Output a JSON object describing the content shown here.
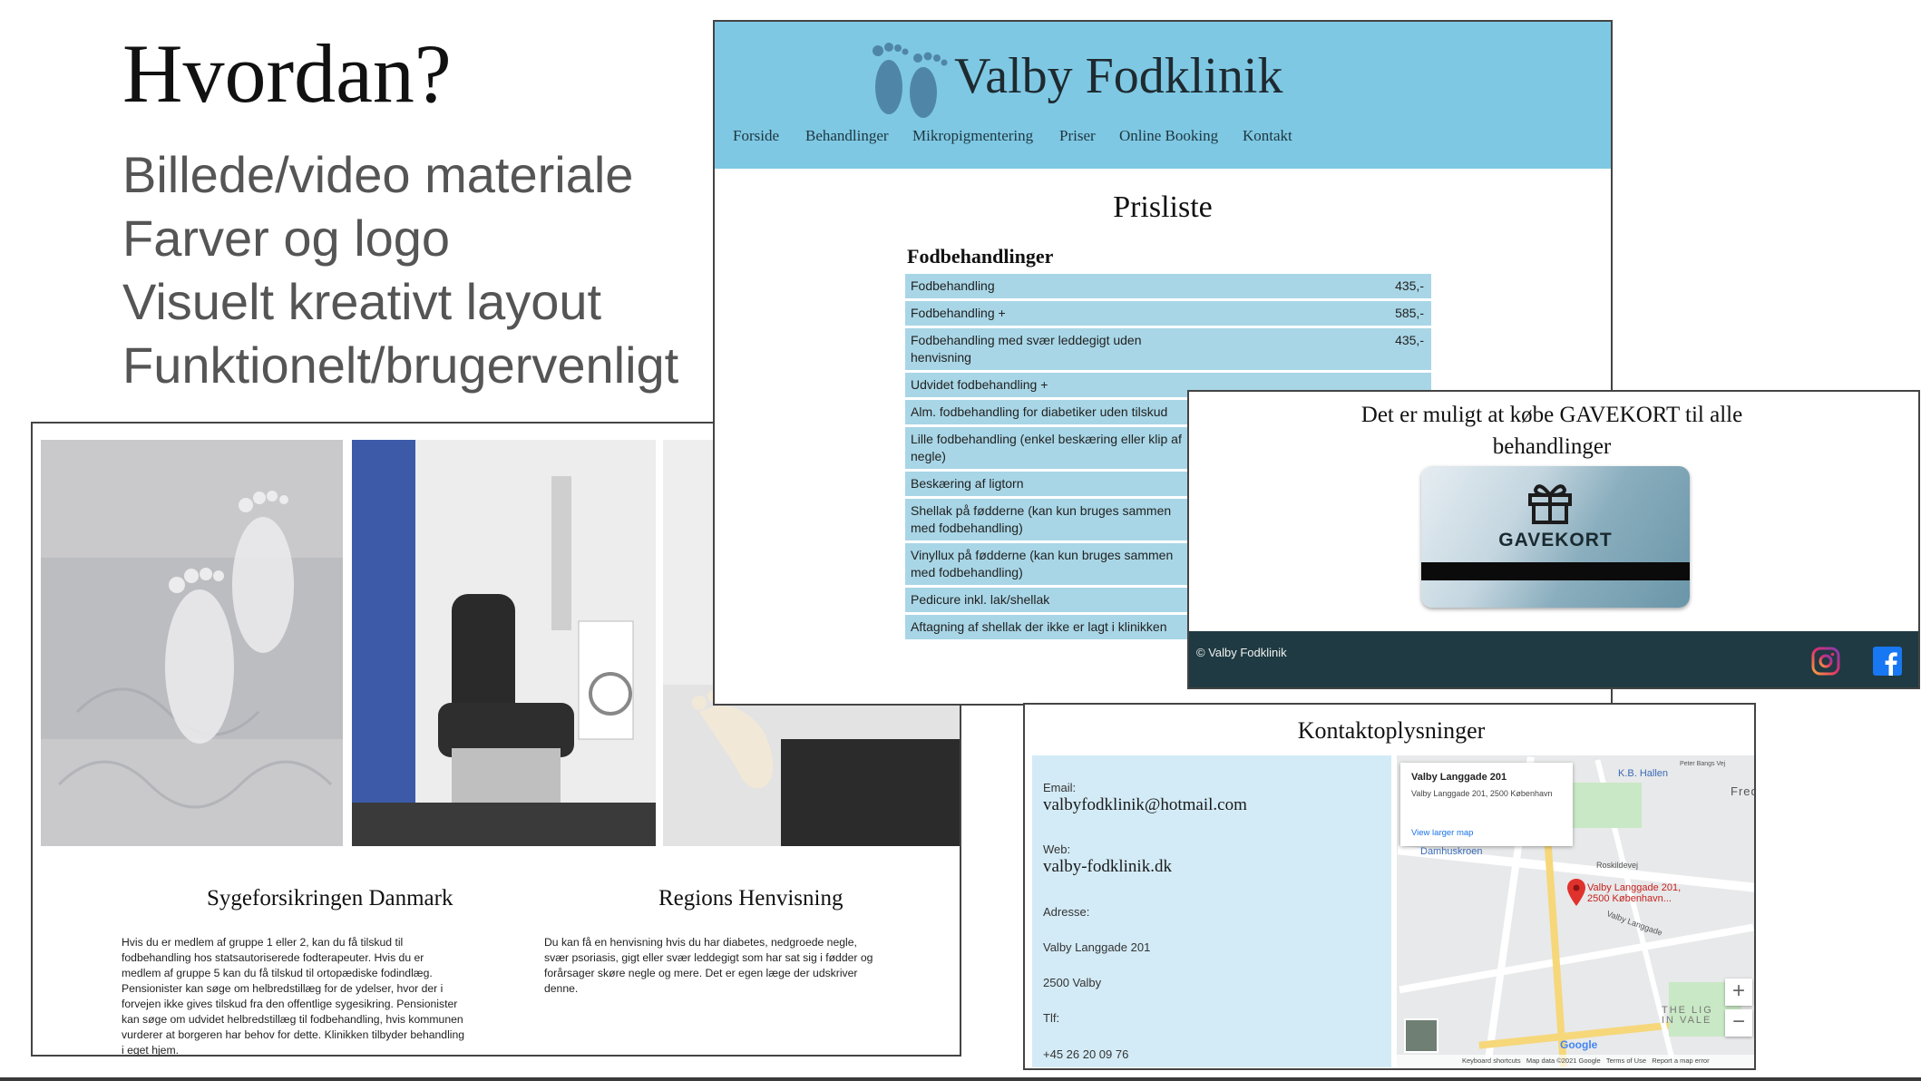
{
  "slide": {
    "title": "Hvordan?",
    "bullets": [
      "Billede/video materiale",
      "Farver og logo",
      "Visuelt kreativt layout",
      "Funktionelt/brugervenligt"
    ]
  },
  "site": {
    "brand": "Valby Fodklinik",
    "nav": [
      "Forside",
      "Behandlinger",
      "Mikropigmentering",
      "Priser",
      "Online Booking",
      "Kontakt"
    ],
    "price_title": "Prisliste",
    "price_section": "Fodbehandlinger",
    "prices": [
      {
        "name": "Fodbehandling",
        "value": "435,-"
      },
      {
        "name": "Fodbehandling +",
        "value": "585,-"
      },
      {
        "name": "Fodbehandling med svær leddegigt uden henvisning",
        "value": "435,-"
      },
      {
        "name": "Udvidet fodbehandling +",
        "value": ""
      },
      {
        "name": "Alm. fodbehandling for diabetiker uden tilskud",
        "value": ""
      },
      {
        "name": "Lille fodbehandling (enkel beskæring eller klip af negle)",
        "value": ""
      },
      {
        "name": "Beskæring af ligtorn",
        "value": ""
      },
      {
        "name": "Shellak på fødderne (kan kun bruges sammen med fodbehandling)",
        "value": ""
      },
      {
        "name": "Vinyllux på fødderne (kan kun bruges sammen med fodbehandling)",
        "value": ""
      },
      {
        "name": "Pedicure inkl. lak/shellak",
        "value": ""
      },
      {
        "name": "Aftagning af shellak der ikke er lagt i klinikken",
        "value": ""
      }
    ]
  },
  "gift": {
    "text": "Det er muligt at købe GAVEKORT til alle behandlinger",
    "card_label": "GAVEKORT",
    "footer": "© Valby Fodklinik"
  },
  "gallery": {
    "col1_title": "Sygeforsikringen Danmark",
    "col1_text": "Hvis du er medlem af gruppe 1 eller 2, kan du få tilskud til fodbehandling hos statsautoriserede fodterapeuter. Hvis du er medlem af gruppe 5 kan du få tilskud til ortopædiske fodindlæg. Pensionister kan søge om helbredstillæg for de ydelser, hvor der i forvejen ikke gives tilskud fra den offentlige sygesikring. Pensionister kan søge om udvidet helbredstillæg til fodbehandling, hvis kommunen vurderer at borgeren har behov for dette. Klinikken tilbyder behandling i eget hjem.",
    "col2_title": "Regions Henvisning",
    "col2_text": "Du kan få en henvisning hvis du har diabetes, nedgroede negle, svær psoriasis, gigt eller svær leddegigt som har sat sig i fødder og forårsager skøre negle og mere. Det er egen læge der udskriver denne."
  },
  "contact": {
    "title": "Kontaktoplysninger",
    "email_label": "Email:",
    "email": "valbyfodklinik@hotmail.com",
    "web_label": "Web:",
    "web": "valby-fodklinik.dk",
    "address_label": "Adresse:",
    "address_line1": "Valby Langgade 201",
    "address_line2": "2500 Valby",
    "phone_label": "Tlf:",
    "phone": "+45 26 20 09 76"
  },
  "map": {
    "popup_title": "Valby Langgade 201",
    "popup_address": "Valby Langgade 201, 2500 København",
    "popup_link": "View larger map",
    "pin_label": "Valby Langgade 201, 2500 København...",
    "labels": [
      "K.B. Hallen",
      "Damhuskroen",
      "Roskildevej",
      "Valby Langgade",
      "Peter Bangs Vej",
      "Fred",
      "THE LIG IN VALE"
    ],
    "footer": "Keyboard shortcuts   Map data ©2021 Google   Terms of Use   Report a map error",
    "google": "Google",
    "zoom_in": "+",
    "zoom_out": "−"
  },
  "colors": {
    "header_blue": "#7ec8e3",
    "table_blue": "#a8d6e6",
    "footer_dark": "#1f3a42",
    "contact_bg": "#d3ebf6"
  }
}
